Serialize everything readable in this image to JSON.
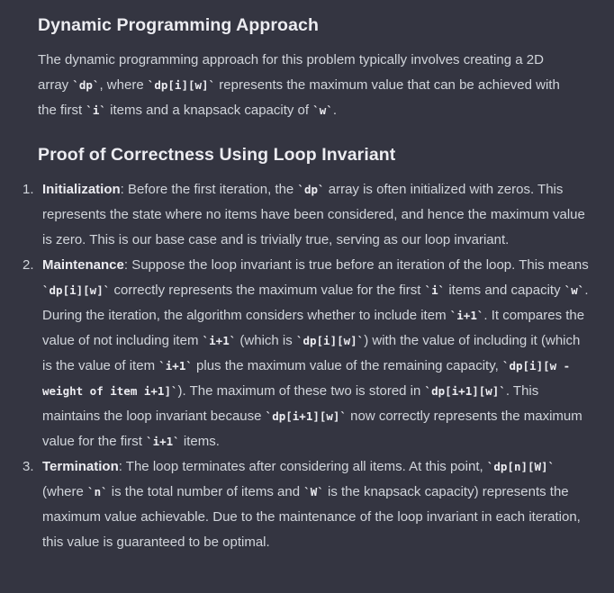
{
  "dp_section": {
    "title": "Dynamic Programming Approach",
    "p1": "The dynamic programming approach for this problem typically involves creating a 2D array ",
    "c1": "dp",
    "p2": ", where ",
    "c2": "dp[i][w]",
    "p3": " represents the maximum value that can be achieved with the first ",
    "c3": "i",
    "p4": " items and a knapsack capacity of ",
    "c4": "w",
    "p5": "."
  },
  "proof_section": {
    "title": "Proof of Correctness Using Loop Invariant",
    "items": [
      {
        "num": "1.",
        "label": "Initialization",
        "t1": ": Before the first iteration, the ",
        "c1": "dp",
        "t2": " array is often initialized with zeros. This represents the state where no items have been considered, and hence the maximum value is zero. This is our base case and is trivially true, serving as our loop invariant."
      },
      {
        "num": "2.",
        "label": "Maintenance",
        "t1": ": Suppose the loop invariant is true before an iteration of the loop. This means ",
        "c1": "dp[i][w]",
        "t2": " correctly represents the maximum value for the first ",
        "c2": "i",
        "t3": " items and capacity ",
        "c3": "w",
        "t4": ". During the iteration, the algorithm considers whether to include item ",
        "c4": "i+1",
        "t5": ". It compares the value of not including item ",
        "c5": "i+1",
        "t6": " (which is ",
        "c6": "dp[i][w]",
        "t7": ") with the value of including it (which is the value of item ",
        "c7": "i+1",
        "t8": " plus the maximum value of the remaining capacity, ",
        "c8": "dp[i][w - weight of item i+1]",
        "t9": "). The maximum of these two is stored in ",
        "c9": "dp[i+1][w]",
        "t10": ". This maintains the loop invariant because ",
        "c10": "dp[i+1][w]",
        "t11": " now correctly represents the maximum value for the first ",
        "c11": "i+1",
        "t12": " items."
      },
      {
        "num": "3.",
        "label": "Termination",
        "t1": ": The loop terminates after considering all items. At this point, ",
        "c1": "dp[n][W]",
        "t2": " (where ",
        "c2": "n",
        "t3": " is the total number of items and ",
        "c3": "W",
        "t4": " is the knapsack capacity) represents the maximum value achievable. Due to the maintenance of the loop invariant in each iteration, this value is guaranteed to be optimal."
      }
    ]
  }
}
